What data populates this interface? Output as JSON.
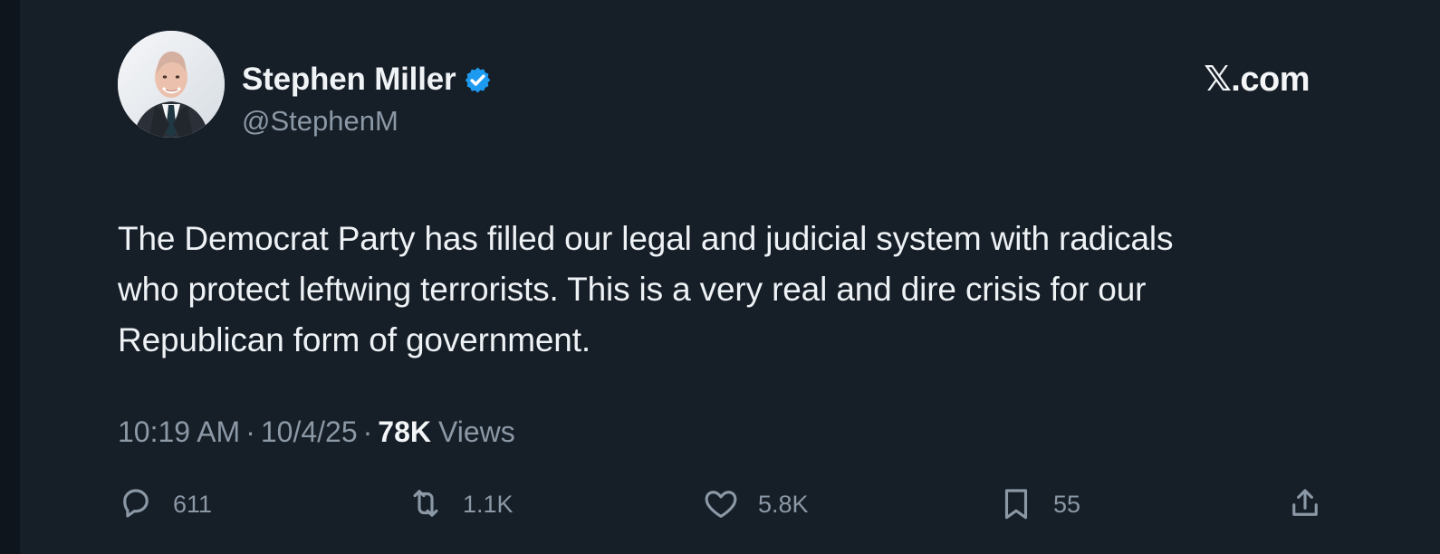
{
  "author": {
    "display_name": "Stephen Miller",
    "handle": "@StephenM",
    "verified": true
  },
  "brand": {
    "label": "𝕏.com"
  },
  "tweet": {
    "lines": [
      "The Democrat Party has filled our legal and judicial system with radicals",
      "who protect leftwing terrorists. This is a very real and dire crisis for our",
      "Republican form of government."
    ]
  },
  "meta": {
    "time": "10:19 AM",
    "separator": "·",
    "date": "10/4/25",
    "views_count": "78K",
    "views_label": "Views"
  },
  "actions": {
    "reply_count": "611",
    "repost_count": "1.1K",
    "like_count": "5.8K",
    "bookmark_count": "55"
  },
  "colors": {
    "background": "#161e28",
    "text": "#eef2f5",
    "secondary_text": "#8b98a5",
    "verified_badge": "#1d9bf0"
  },
  "icons": {
    "verified": "verified-badge-icon",
    "reply": "reply-icon",
    "repost": "repost-icon",
    "like": "heart-icon",
    "bookmark": "bookmark-icon",
    "share": "share-icon"
  }
}
